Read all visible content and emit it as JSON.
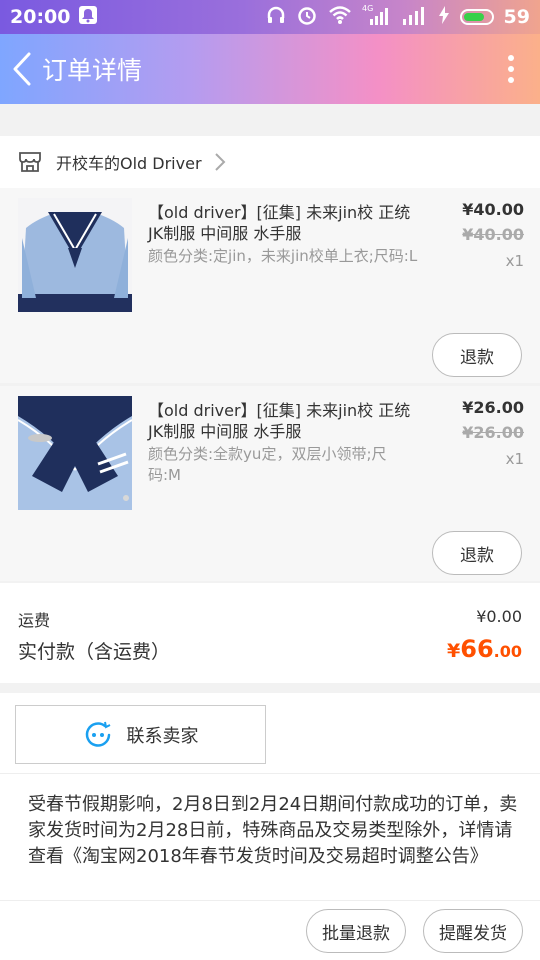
{
  "status_bar": {
    "time": "20:00",
    "battery_level": "59",
    "signal_label": "4G",
    "icons": [
      "notification-icon",
      "headphones-icon",
      "alarm-icon",
      "wifi-icon",
      "cellular-icon",
      "charging-icon",
      "battery-icon"
    ]
  },
  "header": {
    "title": "订单详情",
    "back_icon": "back-chevron-icon",
    "more_icon": "more-vertical-icon"
  },
  "shop": {
    "name": "开校车的Old Driver",
    "icon": "store-icon"
  },
  "items": [
    {
      "title": "【old driver】[征集] 未来jin校 正统JK制服 中间服 水手服",
      "sku": "颜色分类:定jin，未来jin校单上衣;尺码:L",
      "price": "¥40.00",
      "original_price": "¥40.00",
      "quantity": "x1",
      "refund_label": "退款"
    },
    {
      "title": "【old driver】[征集] 未来jin校 正统JK制服 中间服 水手服",
      "sku": "颜色分类:全款yu定，双层小领带;尺码:M",
      "price": "¥26.00",
      "original_price": "¥26.00",
      "quantity": "x1",
      "refund_label": "退款"
    }
  ],
  "totals": {
    "shipping_label": "运费",
    "shipping_value": "¥0.00",
    "paid_label": "实付款（含运费）",
    "paid_currency": "¥",
    "paid_integer": "66",
    "paid_decimal": ".00"
  },
  "contact": {
    "label": "联系卖家",
    "icon": "chat-bubble-icon"
  },
  "notice": {
    "text": "受春节假期影响，2月8日到2月24日期间付款成功的订单，卖家发货时间为2月28日前，特殊商品及交易类型除外，详情请查看《淘宝网2018年春节发货时间及交易超时调整公告》"
  },
  "bottom_bar": {
    "batch_refund_label": "批量退款",
    "remind_ship_label": "提醒发货"
  },
  "colors": {
    "accent_orange": "#ff5000",
    "contact_icon_blue": "#1aa0f0",
    "header_gradient_start": "#7fa6ff",
    "header_gradient_end": "#fbb08a"
  }
}
